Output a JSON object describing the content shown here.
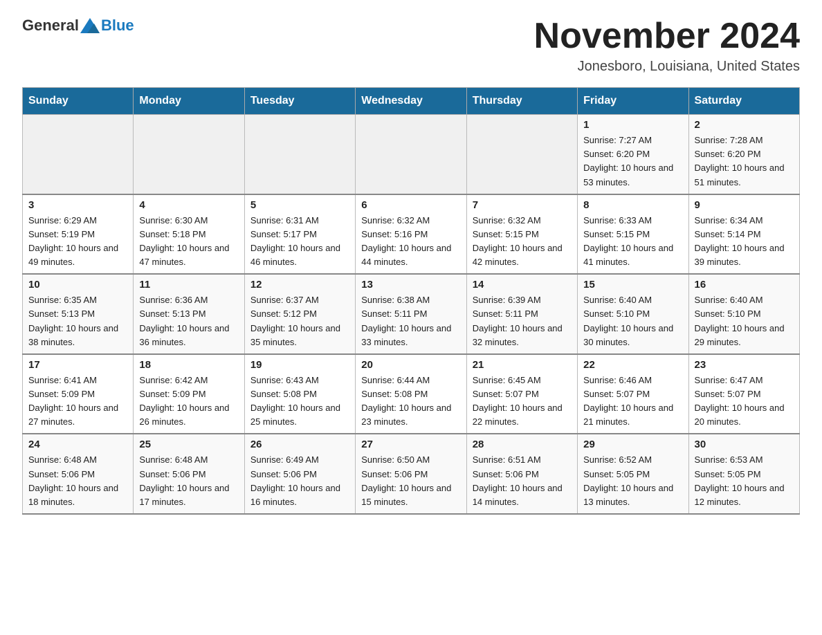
{
  "header": {
    "logo_general": "General",
    "logo_blue": "Blue",
    "month_title": "November 2024",
    "location": "Jonesboro, Louisiana, United States"
  },
  "weekdays": [
    "Sunday",
    "Monday",
    "Tuesday",
    "Wednesday",
    "Thursday",
    "Friday",
    "Saturday"
  ],
  "weeks": [
    [
      {
        "day": "",
        "info": ""
      },
      {
        "day": "",
        "info": ""
      },
      {
        "day": "",
        "info": ""
      },
      {
        "day": "",
        "info": ""
      },
      {
        "day": "",
        "info": ""
      },
      {
        "day": "1",
        "info": "Sunrise: 7:27 AM\nSunset: 6:20 PM\nDaylight: 10 hours and 53 minutes."
      },
      {
        "day": "2",
        "info": "Sunrise: 7:28 AM\nSunset: 6:20 PM\nDaylight: 10 hours and 51 minutes."
      }
    ],
    [
      {
        "day": "3",
        "info": "Sunrise: 6:29 AM\nSunset: 5:19 PM\nDaylight: 10 hours and 49 minutes."
      },
      {
        "day": "4",
        "info": "Sunrise: 6:30 AM\nSunset: 5:18 PM\nDaylight: 10 hours and 47 minutes."
      },
      {
        "day": "5",
        "info": "Sunrise: 6:31 AM\nSunset: 5:17 PM\nDaylight: 10 hours and 46 minutes."
      },
      {
        "day": "6",
        "info": "Sunrise: 6:32 AM\nSunset: 5:16 PM\nDaylight: 10 hours and 44 minutes."
      },
      {
        "day": "7",
        "info": "Sunrise: 6:32 AM\nSunset: 5:15 PM\nDaylight: 10 hours and 42 minutes."
      },
      {
        "day": "8",
        "info": "Sunrise: 6:33 AM\nSunset: 5:15 PM\nDaylight: 10 hours and 41 minutes."
      },
      {
        "day": "9",
        "info": "Sunrise: 6:34 AM\nSunset: 5:14 PM\nDaylight: 10 hours and 39 minutes."
      }
    ],
    [
      {
        "day": "10",
        "info": "Sunrise: 6:35 AM\nSunset: 5:13 PM\nDaylight: 10 hours and 38 minutes."
      },
      {
        "day": "11",
        "info": "Sunrise: 6:36 AM\nSunset: 5:13 PM\nDaylight: 10 hours and 36 minutes."
      },
      {
        "day": "12",
        "info": "Sunrise: 6:37 AM\nSunset: 5:12 PM\nDaylight: 10 hours and 35 minutes."
      },
      {
        "day": "13",
        "info": "Sunrise: 6:38 AM\nSunset: 5:11 PM\nDaylight: 10 hours and 33 minutes."
      },
      {
        "day": "14",
        "info": "Sunrise: 6:39 AM\nSunset: 5:11 PM\nDaylight: 10 hours and 32 minutes."
      },
      {
        "day": "15",
        "info": "Sunrise: 6:40 AM\nSunset: 5:10 PM\nDaylight: 10 hours and 30 minutes."
      },
      {
        "day": "16",
        "info": "Sunrise: 6:40 AM\nSunset: 5:10 PM\nDaylight: 10 hours and 29 minutes."
      }
    ],
    [
      {
        "day": "17",
        "info": "Sunrise: 6:41 AM\nSunset: 5:09 PM\nDaylight: 10 hours and 27 minutes."
      },
      {
        "day": "18",
        "info": "Sunrise: 6:42 AM\nSunset: 5:09 PM\nDaylight: 10 hours and 26 minutes."
      },
      {
        "day": "19",
        "info": "Sunrise: 6:43 AM\nSunset: 5:08 PM\nDaylight: 10 hours and 25 minutes."
      },
      {
        "day": "20",
        "info": "Sunrise: 6:44 AM\nSunset: 5:08 PM\nDaylight: 10 hours and 23 minutes."
      },
      {
        "day": "21",
        "info": "Sunrise: 6:45 AM\nSunset: 5:07 PM\nDaylight: 10 hours and 22 minutes."
      },
      {
        "day": "22",
        "info": "Sunrise: 6:46 AM\nSunset: 5:07 PM\nDaylight: 10 hours and 21 minutes."
      },
      {
        "day": "23",
        "info": "Sunrise: 6:47 AM\nSunset: 5:07 PM\nDaylight: 10 hours and 20 minutes."
      }
    ],
    [
      {
        "day": "24",
        "info": "Sunrise: 6:48 AM\nSunset: 5:06 PM\nDaylight: 10 hours and 18 minutes."
      },
      {
        "day": "25",
        "info": "Sunrise: 6:48 AM\nSunset: 5:06 PM\nDaylight: 10 hours and 17 minutes."
      },
      {
        "day": "26",
        "info": "Sunrise: 6:49 AM\nSunset: 5:06 PM\nDaylight: 10 hours and 16 minutes."
      },
      {
        "day": "27",
        "info": "Sunrise: 6:50 AM\nSunset: 5:06 PM\nDaylight: 10 hours and 15 minutes."
      },
      {
        "day": "28",
        "info": "Sunrise: 6:51 AM\nSunset: 5:06 PM\nDaylight: 10 hours and 14 minutes."
      },
      {
        "day": "29",
        "info": "Sunrise: 6:52 AM\nSunset: 5:05 PM\nDaylight: 10 hours and 13 minutes."
      },
      {
        "day": "30",
        "info": "Sunrise: 6:53 AM\nSunset: 5:05 PM\nDaylight: 10 hours and 12 minutes."
      }
    ]
  ]
}
